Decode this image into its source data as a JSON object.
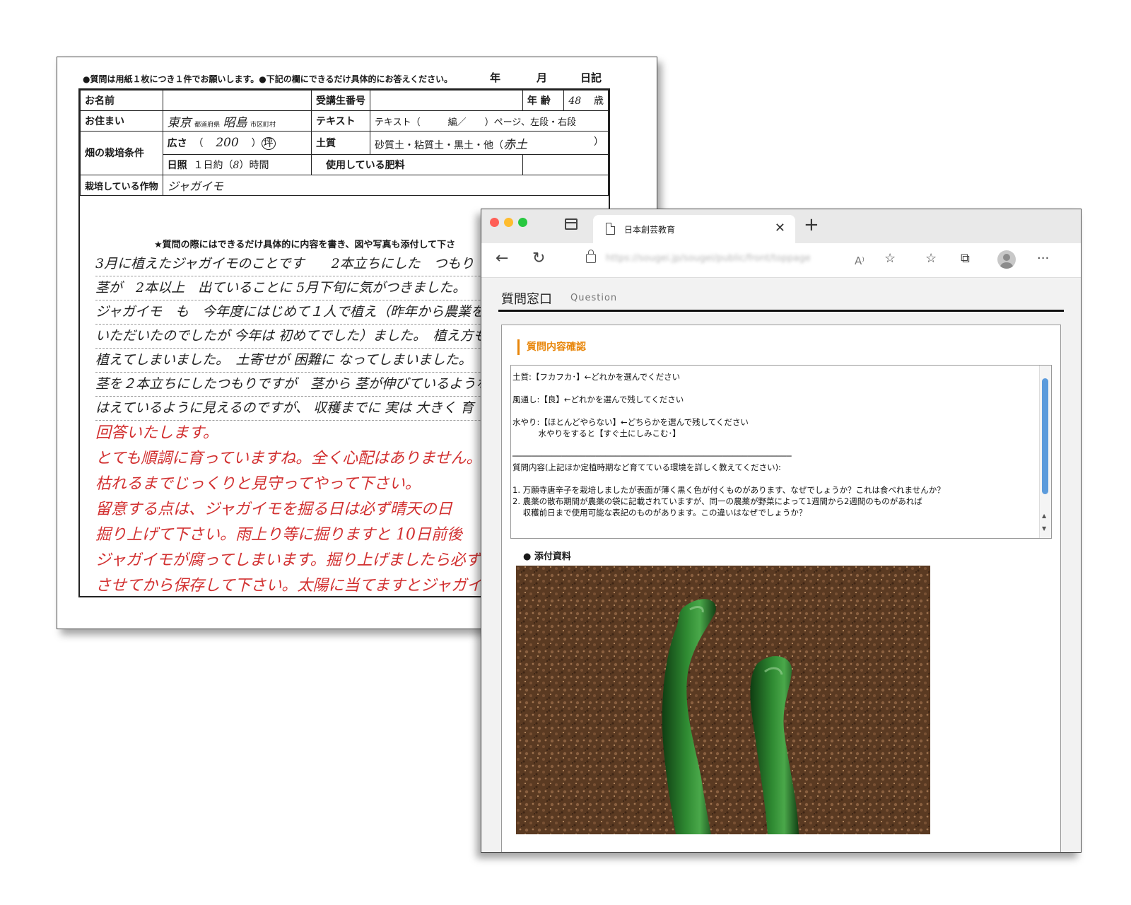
{
  "form": {
    "note": "●質問は用紙１枚につき１件でお願いします。●下記の欄にできるだけ具体的にお答えください。",
    "date_year": "年",
    "date_month": "月",
    "date_day": "日記",
    "name_label": "お名前",
    "student_no_label": "受講生番号",
    "age_label": "年 齢",
    "age_value": "48",
    "age_unit": "歳",
    "address_label": "お住まい",
    "address_pref": "東京",
    "address_pref_suffix": "都道府県",
    "address_city": "昭島",
    "address_city_suffix": "市区町村",
    "text_label": "テキスト",
    "text_value": "テキスト（　　　編／　　）ページ、左段・右段",
    "conditions_label": "畑の栽培条件",
    "area_label": "広さ",
    "area_value": "200",
    "area_unit": "坪",
    "soil_label": "土質",
    "soil_value": "砂質土・粘質土・黒土・他（",
    "soil_hand": "赤土",
    "soil_close": "）",
    "sun_label": "日照",
    "sun_value_prefix": "１日約（",
    "sun_hours": "8",
    "sun_value_suffix": "）時間",
    "fertilizer_label": "使用している肥料",
    "crop_label": "栽培している作物",
    "crop_value": "ジャガイモ",
    "hint": "★質問の際にはできるだけ具体的に内容を書き、図や写真も添付して下さ",
    "question_lines": [
      "3月に植えたジャガイモのことです　　2本立ちにした　つもり",
      "茎が　2本以上　出ていることに 5月下旬に気がつきました。",
      "ジャガイモ　も　今年度にはじめて１人で植え（昨年から農業を",
      "いただいたのでしたが 今年は 初めてでした）ました。　植え方も",
      "植えてしまいました。　土寄せが 困難に なってしまいました。",
      "茎を２本立ちにしたつもりですが　茎から 茎が伸びているような",
      "はえているように見えるのですが、 収穫までに 実は 大きく 育"
    ],
    "answer_lines": [
      "回答いたします。",
      "とても順調に育っていますね。全く心配はありません。",
      "枯れるまでじっくりと見守ってやって下さい。",
      "留意する点は、ジャガイモを掘る日は必ず晴天の日",
      "掘り上げて下さい。雨上り等に掘りますと 10日前後",
      "ジャガイモが腐ってしまいます。掘り上げましたら必ず日陰",
      "させてから保存して下さい。太陽に当てますとジャガイモが緑色"
    ]
  },
  "browser": {
    "tab_title": "日本創芸教育",
    "url": "https://sougei.jp/sougei/public/front/toppage",
    "page_title": "質問窓口",
    "page_subtitle": "Question",
    "section_title": "質問内容確認",
    "question_text": "土質:【フカフカ･】←どれかを選んでください\n\n風通し:【良】←どれかを選んで残してください\n\n水やり:【ほとんどやらない】←どちらかを選んで残してください\n          水やりをすると【すぐ土にしみこむ･】\n\n─────────────────────────────────────────────────────────\n質問内容(上記ほか定植時期など育てている環境を詳しく教えてください):\n\n1. 万願寺唐辛子を栽培しましたが表面が薄く黒く色が付くものがあります、なぜでしょうか？これは食べれませんか？\n2. 農薬の散布期間が農薬の袋に記載されていますが、同一の農薬が野菜によって1週間から2週間のものがあれば\n    収穫前日まで使用可能な表記のものがあります。この違いはなぜでしょうか？",
    "attachment_label": "● 添付資料"
  },
  "colors": {
    "accent_orange": "#e8860a",
    "teacher_red": "#d23030",
    "scrollbar_blue": "#5b9bdc",
    "mac_red": "#ff5f57",
    "mac_yellow": "#febc2e",
    "mac_green": "#28c840"
  },
  "icons": [
    "back-icon",
    "reload-icon",
    "lock-icon",
    "read-aloud-icon",
    "add-favorite-icon",
    "favorites-icon",
    "collections-icon",
    "profile-icon",
    "more-icon",
    "tab-actions-icon",
    "document-icon",
    "close-icon",
    "new-tab-icon"
  ]
}
